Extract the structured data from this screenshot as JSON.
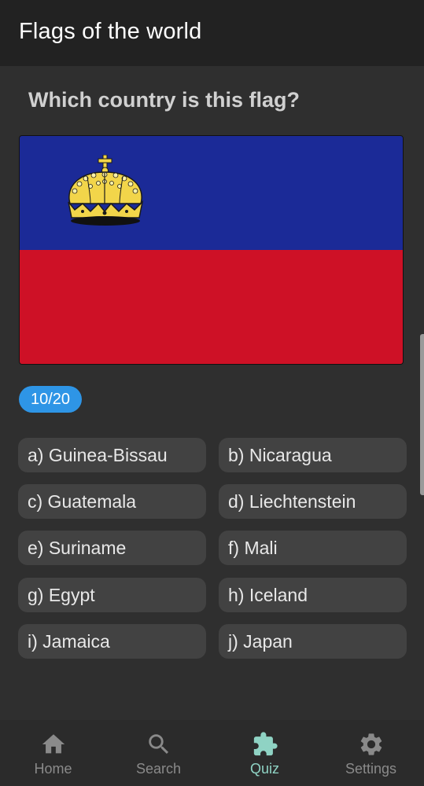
{
  "app_bar": {
    "title": "Flags of the world"
  },
  "question": "Which country is this flag?",
  "flag": {
    "top_color": "#1b2a97",
    "bottom_color": "#ce1126",
    "emblem": "crown-icon",
    "crown_color": "#f2d54a"
  },
  "progress": {
    "label": "10/20",
    "current": 10,
    "total": 20
  },
  "options": [
    {
      "label": "a) Guinea-Bissau"
    },
    {
      "label": "b) Nicaragua"
    },
    {
      "label": "c) Guatemala"
    },
    {
      "label": "d) Liechtenstein"
    },
    {
      "label": "e) Suriname"
    },
    {
      "label": "f) Mali"
    },
    {
      "label": "g) Egypt"
    },
    {
      "label": "h) Iceland"
    },
    {
      "label": "i) Jamaica"
    },
    {
      "label": "j) Japan"
    }
  ],
  "bottom_nav": {
    "items": [
      {
        "label": "Home",
        "icon": "home-icon",
        "active": false
      },
      {
        "label": "Search",
        "icon": "search-icon",
        "active": false
      },
      {
        "label": "Quiz",
        "icon": "puzzle-icon",
        "active": true
      },
      {
        "label": "Settings",
        "icon": "gear-icon",
        "active": false
      }
    ],
    "active_color": "#8fd3c4",
    "inactive_color": "#8a8a8a"
  }
}
